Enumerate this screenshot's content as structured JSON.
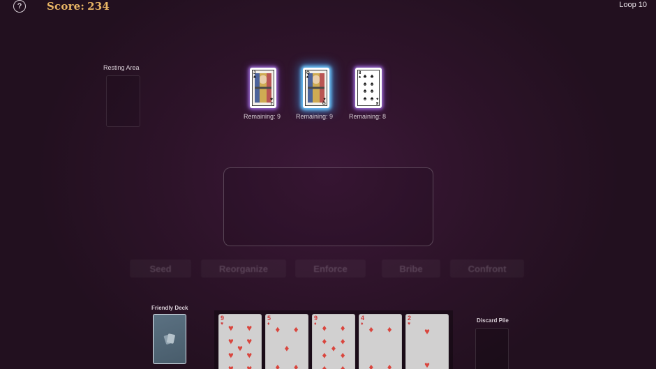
{
  "header": {
    "help_glyph": "?",
    "score_label": "Score:",
    "score_value": "234",
    "loop_text": "Loop 10"
  },
  "resting_area": {
    "label": "Resting Area"
  },
  "enemies": [
    {
      "rank": "J",
      "suit": "♣",
      "remaining": "Remaining: 9",
      "selected": false
    },
    {
      "rank": "Q",
      "suit": "♠",
      "remaining": "Remaining: 9",
      "selected": true
    },
    {
      "rank": "8",
      "suit": "♠",
      "remaining": "Remaining: 8",
      "selected": false
    }
  ],
  "actions": [
    {
      "label": "Seed"
    },
    {
      "label": "Reorganize"
    },
    {
      "label": "Enforce"
    },
    {
      "label": "Bribe"
    },
    {
      "label": "Confront"
    }
  ],
  "friendly_deck": {
    "label": "Friendly Deck",
    "icon": "cards-icon"
  },
  "hand": [
    {
      "rank": "9",
      "suit": "♥"
    },
    {
      "rank": "5",
      "suit": "♦"
    },
    {
      "rank": "9",
      "suit": "♦"
    },
    {
      "rank": "4",
      "suit": "♦"
    },
    {
      "rank": "2",
      "suit": "♥"
    }
  ],
  "discard_pile": {
    "label": "Discard Pile"
  },
  "colors": {
    "score": "#e8b565",
    "selected_glow": "#6ec8ff",
    "enemy_glow": "#aa78e6",
    "red_suit": "#d9453d"
  }
}
